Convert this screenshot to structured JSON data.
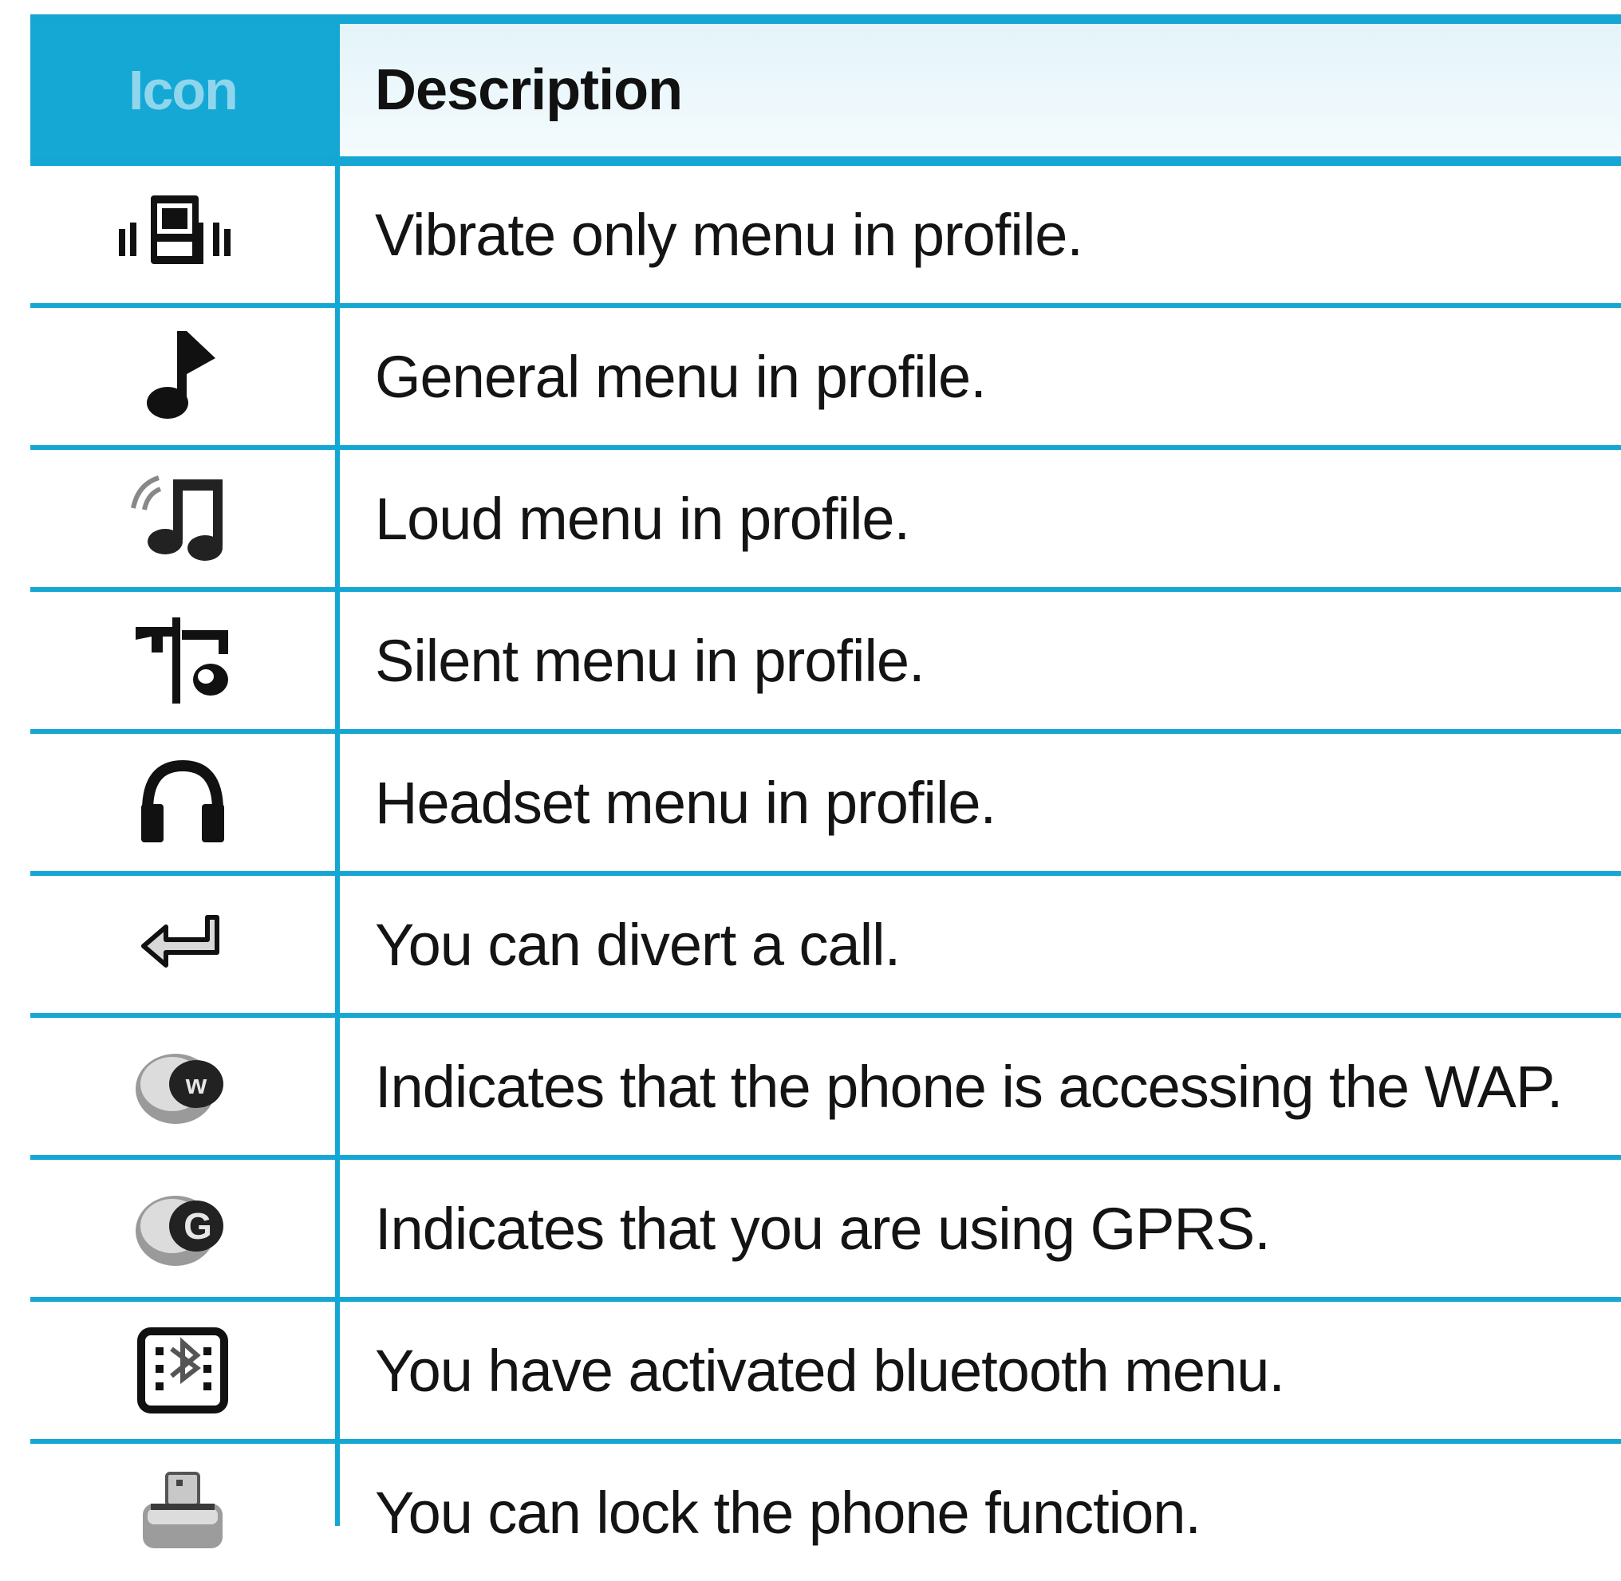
{
  "table": {
    "header": {
      "icon": "Icon",
      "description": "Description"
    },
    "rows": [
      {
        "icon": "vibrate-icon",
        "description": "Vibrate only menu in profile."
      },
      {
        "icon": "music-note-icon",
        "description": "General menu in profile."
      },
      {
        "icon": "loud-note-icon",
        "description": "Loud menu in profile."
      },
      {
        "icon": "silent-icon",
        "description": "Silent menu in profile."
      },
      {
        "icon": "headset-icon",
        "description": "Headset menu in profile."
      },
      {
        "icon": "divert-call-icon",
        "description": "You can divert a call."
      },
      {
        "icon": "wap-icon",
        "description": "Indicates that the phone is accessing the WAP."
      },
      {
        "icon": "gprs-icon",
        "description": "Indicates that you are using GPRS."
      },
      {
        "icon": "bluetooth-icon",
        "description": "You have activated bluetooth menu."
      },
      {
        "icon": "lock-icon",
        "description": "You can lock the phone function."
      }
    ]
  },
  "colors": {
    "accent": "#14a7d3",
    "header_bg": "#e4f4fa",
    "text": "#141414"
  }
}
